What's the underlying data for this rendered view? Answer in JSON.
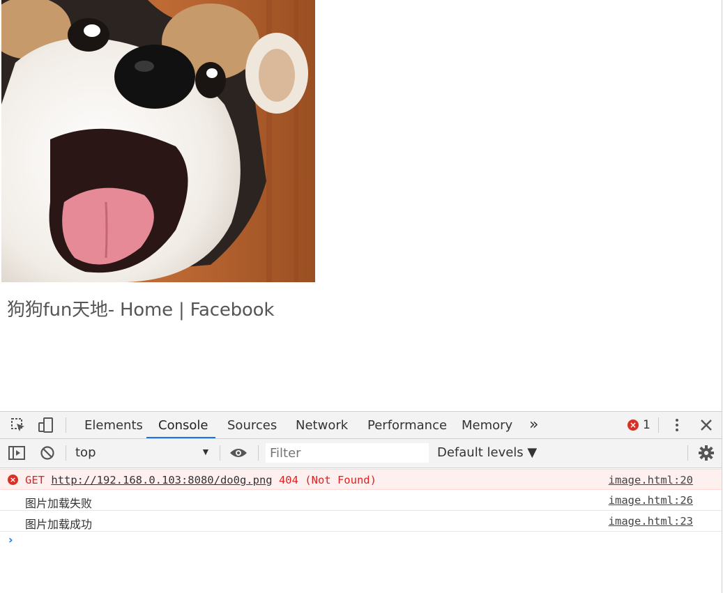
{
  "page": {
    "caption": "狗狗fun天地- Home | Facebook"
  },
  "devtools": {
    "tabs": [
      "Elements",
      "Console",
      "Sources",
      "Network",
      "Performance",
      "Memory"
    ],
    "more_tabs_glyph": "»",
    "error_count": "1",
    "context": "top",
    "filter_placeholder": "Filter",
    "levels": "Default levels ▼",
    "logs": [
      {
        "method": "GET",
        "url": "http://192.168.0.103:8080/do0g.png",
        "status": "404 (Not Found)",
        "source": "image.html:20"
      },
      {
        "text": "图片加载失败",
        "source": "image.html:26"
      },
      {
        "text": "图片加载成功",
        "source": "image.html:23"
      }
    ]
  },
  "colors": {
    "accent": "#1a73e8",
    "error": "#d93025"
  }
}
